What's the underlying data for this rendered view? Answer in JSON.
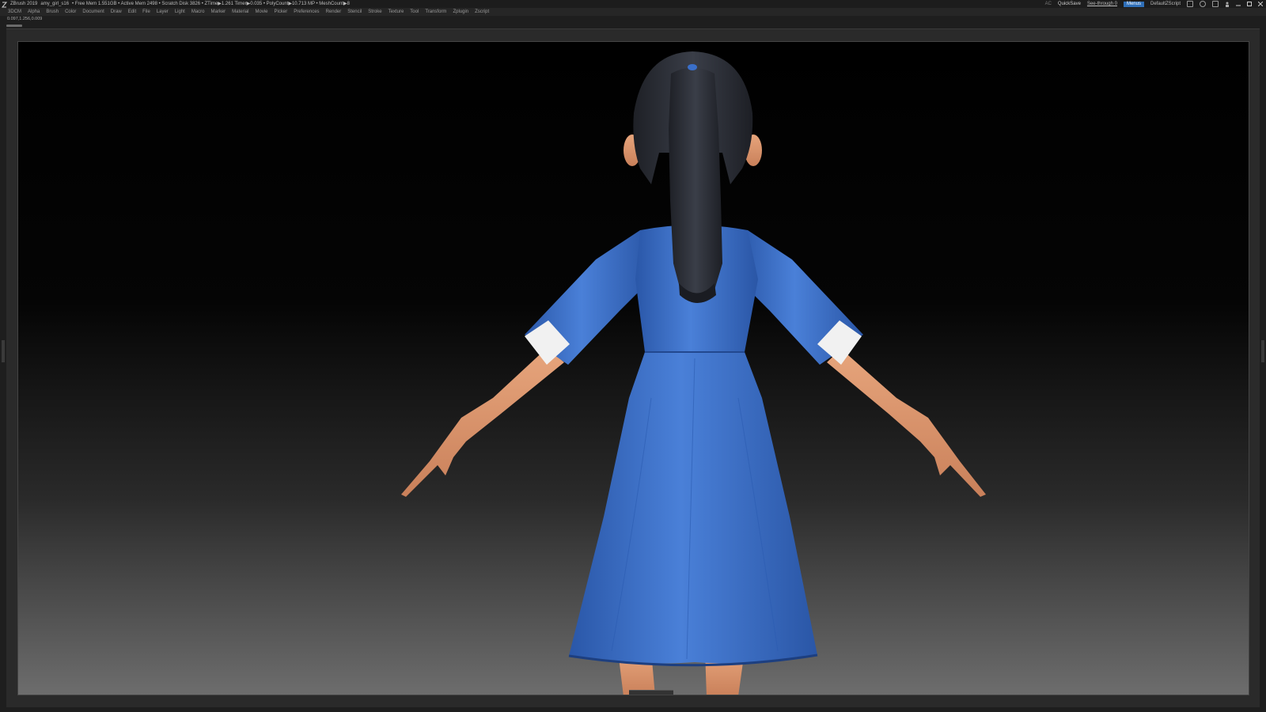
{
  "titlebar": {
    "app": "ZBrush 2019",
    "file": "amy_girl_s16",
    "stats": "• Free Mem 1.551GB • Active Mem 2498 • Scratch Disk 3826 • ZTime▶1.261 Timer▶0.035 • PolyCount▶10.713 MP • MeshCount▶8",
    "ac": "AC",
    "quicksave": "QuickSave",
    "see_through": "See-through 0",
    "see_through_level": 0.4,
    "menus_button": "Menus",
    "default_script": "DefaultZScript"
  },
  "menubar": [
    "3DCM",
    "Alpha",
    "Brush",
    "Color",
    "Document",
    "Draw",
    "Edit",
    "File",
    "Layer",
    "Light",
    "Macro",
    "Marker",
    "Material",
    "Movie",
    "Picker",
    "Preferences",
    "Render",
    "Stencil",
    "Stroke",
    "Texture",
    "Tool",
    "Transform",
    "Zplugin",
    "Zscript"
  ],
  "coords": "0.097,1.256,0.009",
  "colors": {
    "dress": "#3a6fc9",
    "dress_dark": "#22488f",
    "skin": "#e3a07a",
    "hair": "#2a2d35",
    "cuff": "#f2f2f2",
    "accent": "#2f6fb8"
  },
  "icons": [
    "zbrush-logo-icon",
    "layout-icon",
    "rotate-icon",
    "palette-icon",
    "user-icon",
    "minimize-icon",
    "maximize-icon",
    "close-icon"
  ]
}
